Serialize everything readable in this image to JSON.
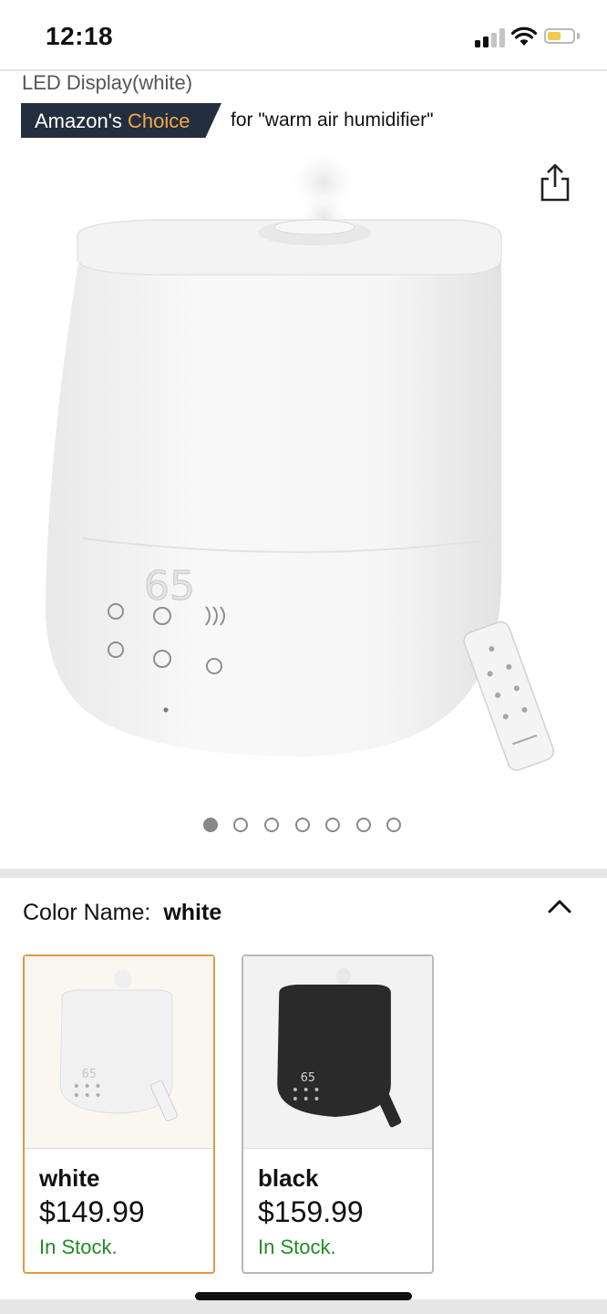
{
  "status_bar": {
    "time": "12:18",
    "signal_bars": 4,
    "signal_bars_active": 2,
    "battery_level": 0.55,
    "colors": {
      "battery_fill": "#f2c94c",
      "signal_active": "#111111",
      "signal_inactive": "#c4c4c4"
    }
  },
  "product": {
    "title_fragment": "LED Display(white)",
    "badge": {
      "prefix": "Amazon's ",
      "accent": "Choice"
    },
    "badge_for": "for \"warm air humidifier\"",
    "image": {
      "display_digits": "65",
      "icon": "humidifier-product-image"
    },
    "share_icon": "share-icon",
    "carousel": {
      "count": 7,
      "active_index": 0
    }
  },
  "variation": {
    "label": "Color Name:",
    "selected_value": "white",
    "options": [
      {
        "name": "white",
        "price": "$149.99",
        "stock": "In Stock.",
        "selected": true,
        "thumb_bg": "#faf6f0",
        "body_color": "#f1f1f1"
      },
      {
        "name": "black",
        "price": "$159.99",
        "stock": "In Stock.",
        "selected": false,
        "thumb_bg": "#f2f2f2",
        "body_color": "#2a2a2a"
      }
    ]
  },
  "theme": {
    "accent_orange": "#f3a847",
    "badge_bg": "#232f3e",
    "stock_green": "#228b22",
    "selected_border": "#e0994a"
  }
}
